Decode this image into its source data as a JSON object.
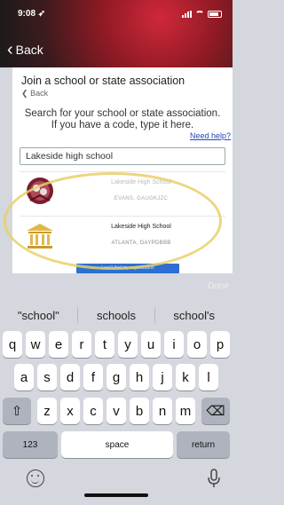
{
  "status": {
    "time": "9:08 ➶"
  },
  "nav": {
    "back_label": "Back"
  },
  "page": {
    "title": "Join a school or state association",
    "sub_back": "Back",
    "instructions_line1": "Search for your school or state association.",
    "instructions_line2": "If you have a code, type it here.",
    "need_help": "Need help?"
  },
  "search": {
    "value": "Lakeside high school"
  },
  "results": [
    {
      "name": "Lakeside High School",
      "location": "EVANS, GAUGKJZC",
      "logo": "school-crest-icon"
    },
    {
      "name": "Lakeside High School",
      "location": "ATLANTA, GAYPDBBB",
      "logo": "school-building-icon"
    }
  ],
  "cant_find_label": "I can't find my organization",
  "keyboard": {
    "done_label": "Done",
    "suggestions": [
      "\"school\"",
      "schools",
      "school's"
    ],
    "row1": [
      "q",
      "w",
      "e",
      "r",
      "t",
      "y",
      "u",
      "i",
      "o",
      "p"
    ],
    "row2": [
      "a",
      "s",
      "d",
      "f",
      "g",
      "h",
      "j",
      "k",
      "l"
    ],
    "row3": [
      "z",
      "x",
      "c",
      "v",
      "b",
      "n",
      "m"
    ],
    "shift_glyph": "⇧",
    "delete_glyph": "⌫",
    "numbers_label": "123",
    "space_label": "space",
    "return_label": "return"
  },
  "colors": {
    "accent": "#2d6fd2",
    "highlight": "#e8d068",
    "header": "#8e1a24"
  }
}
